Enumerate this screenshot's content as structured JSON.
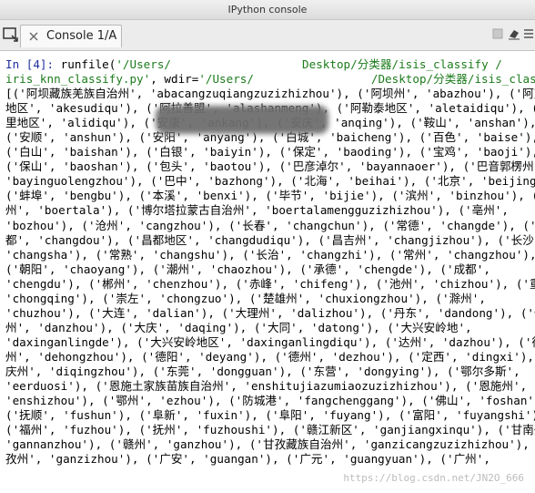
{
  "window": {
    "title": "IPython console"
  },
  "tab": {
    "label": "Console 1/A"
  },
  "input": {
    "prompt": "In [4]: ",
    "code_line1_pre": "runfile(",
    "code_line1_str": "'/Users/                   Desktop/分类器/isis_classify /",
    "code_line2_str": "iris_knn_classify.py'",
    "code_line2_mid": ", wdir=",
    "code_line2_str2": "'/Users/                 /Desktop/分类器/isis_classify '",
    "code_line2_post": ")"
  },
  "output": {
    "lines": [
      "[('阿坝藏族羌族自治州', 'abacangzuqiangzuzizhizhou'), ('阿坝州', 'abazhou'), ('阿克苏",
      "地区', 'akesudiqu'), ('阿拉善盟', 'alashanmeng'), ('阿勒泰地区', 'aletaidiqu'), ('阿",
      "里地区', 'alidiqu'), ('安康', 'ankang'), ('安庆', 'anqing'), ('鞍山', 'anshan'),",
      "('安顺', 'anshun'), ('安阳', 'anyang'), ('白城', 'baicheng'), ('百色', 'baise'),",
      "('白山', 'baishan'), ('白银', 'baiyin'), ('保定', 'baoding'), ('宝鸡', 'baoji'),",
      "('保山', 'baoshan'), ('包头', 'baotou'), ('巴彦淖尔', 'bayannaoer'), ('巴音郭楞州',",
      "'bayinguolengzhou'), ('巴中', 'bazhong'), ('北海', 'beihai'), ('北京', 'beijing'),",
      "('蚌埠', 'bengbu'), ('本溪', 'benxi'), ('毕节', 'bijie'), ('滨州', 'binzhou'), ('博",
      "州', 'boertala'), ('博尔塔拉蒙古自治州', 'boertalamengguzizhizhou'), ('亳州',",
      "'bozhou'), ('沧州', 'cangzhou'), ('长春', 'changchun'), ('常德', 'changde'), ('昌",
      "都', 'changdou'), ('昌都地区', 'changdudiqu'), ('昌吉州', 'changjizhou'), ('长沙',",
      "'changsha'), ('常熟', 'changshu'), ('长治', 'changzhi'), ('常州', 'changzhou'),",
      "('朝阳', 'chaoyang'), ('潮州', 'chaozhou'), ('承德', 'chengde'), ('成都',",
      "'chengdu'), ('郴州', 'chenzhou'), ('赤峰', 'chifeng'), ('池州', 'chizhou'), ('重庆',",
      "'chongqing'), ('崇左', 'chongzuo'), ('楚雄州', 'chuxiongzhou'), ('滁州',",
      "'chuzhou'), ('大连', 'dalian'), ('大理州', 'dalizhou'), ('丹东', 'dandong'), ('儋",
      "州', 'danzhou'), ('大庆', 'daqing'), ('大同', 'datong'), ('大兴安岭地',",
      "'daxinganlingde'), ('大兴安岭地区', 'daxinganlingdiqu'), ('达州', 'dazhou'), ('德宏",
      "州', 'dehongzhou'), ('德阳', 'deyang'), ('德州', 'dezhou'), ('定西', 'dingxi'), ('迪",
      "庆州', 'diqingzhou'), ('东莞', 'dongguan'), ('东营', 'dongying'), ('鄂尔多斯',",
      "'eerduosi'), ('恩施土家族苗族自治州', 'enshitujiazumiaozuzizhizhou'), ('恩施州',",
      "'enshizhou'), ('鄂州', 'ezhou'), ('防城港', 'fangchenggang'), ('佛山', 'foshan'),",
      "('抚顺', 'fushun'), ('阜新', 'fuxin'), ('阜阳', 'fuyang'), ('富阳', 'fuyangshi'),",
      "('福州', 'fuzhou'), ('抚州', 'fuzhoushi'), ('赣江新区', 'ganjiangxinqu'), ('甘南州',",
      "'gannanzhou'), ('赣州', 'ganzhou'), ('甘孜藏族自治州', 'ganzicangzuzizhizhou'), ('甘",
      "孜州', 'ganzizhou'), ('广安', 'guangan'), ('广元', 'guangyuan'), ('广州',"
    ]
  },
  "watermark": "https://blog.csdn.net/JN2O_666",
  "colors": {
    "prompt": "#1f2f9f",
    "string": "#1c7c1c",
    "text": "#000000",
    "titlebar": "#e4e4e4",
    "tabbar": "#ececec"
  },
  "icons": [
    "console-icon",
    "close-icon",
    "square-icon",
    "eraser-icon",
    "menu-icon"
  ]
}
